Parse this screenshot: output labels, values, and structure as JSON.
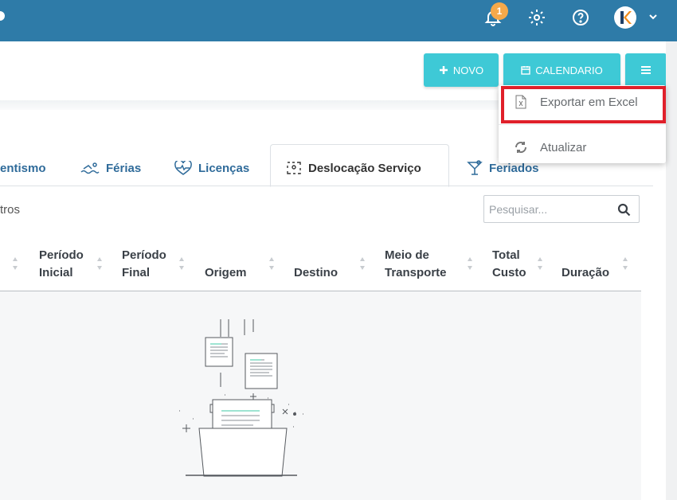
{
  "header": {
    "notification_count": "1",
    "icons": [
      "bell-icon",
      "gear-icon",
      "help-icon",
      "avatar",
      "chevron-down-icon"
    ]
  },
  "actions": {
    "novo_label": "NOVO",
    "calendario_label": "CALENDARIO",
    "menu_icon": "hamburger-icon"
  },
  "dropdown": {
    "items": [
      {
        "label": "Exportar em Excel",
        "icon": "excel-file-icon"
      },
      {
        "label": "Atualizar",
        "icon": "refresh-icon"
      }
    ]
  },
  "tabs": [
    {
      "label": "entismo",
      "icon": ""
    },
    {
      "label": "Férias",
      "icon": "swimmer-icon"
    },
    {
      "label": "Licenças",
      "icon": "heart-pulse-icon"
    },
    {
      "label": "Deslocação Serviço",
      "icon": "route-icon",
      "active": true
    },
    {
      "label": "Feriados",
      "icon": "cocktail-icon"
    }
  ],
  "list": {
    "records_text_fragment": "tros",
    "search_placeholder": "Pesquisar..."
  },
  "table": {
    "columns": [
      {
        "line1": "Período",
        "line2": "Inicial"
      },
      {
        "line1": "Período",
        "line2": "Final"
      },
      {
        "line1": "",
        "line2": "Origem"
      },
      {
        "line1": "",
        "line2": "Destino"
      },
      {
        "line1": "Meio de",
        "line2": "Transporte"
      },
      {
        "line1": "Total",
        "line2": "Custo"
      },
      {
        "line1": "",
        "line2": "Duração"
      }
    ],
    "rows": []
  },
  "colors": {
    "topbar": "#2e7ba8",
    "button": "#3ec9d6",
    "tab_text": "#2f6b9a",
    "badge": "#f5a94a",
    "highlight": "#e0202a"
  }
}
